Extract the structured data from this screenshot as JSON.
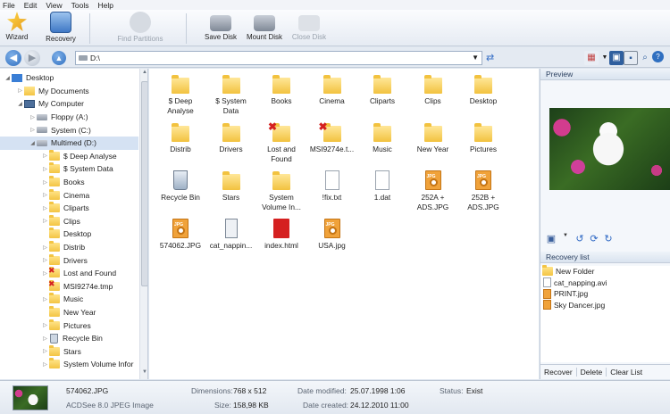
{
  "menu": [
    "File",
    "Edit",
    "View",
    "Tools",
    "Help"
  ],
  "toolbar": {
    "wizard": "Wizard",
    "recovery": "Recovery",
    "find_partitions": "Find Partitions",
    "save_disk": "Save Disk",
    "mount_disk": "Mount Disk",
    "close_disk": "Close Disk"
  },
  "address": {
    "path": "D:\\"
  },
  "tree": [
    {
      "label": "Desktop",
      "icon": "desk"
    },
    {
      "label": "My Documents",
      "icon": "docs"
    },
    {
      "label": "My Computer",
      "icon": "computer"
    },
    {
      "label": "Floppy (A:)",
      "icon": "drive"
    },
    {
      "label": "System (C:)",
      "icon": "drive"
    },
    {
      "label": "Multimed (D:)",
      "icon": "drive"
    },
    {
      "label": "$ Deep Analyse",
      "icon": "folder"
    },
    {
      "label": "$ System Data",
      "icon": "folder"
    },
    {
      "label": "Books",
      "icon": "folder"
    },
    {
      "label": "Cinema",
      "icon": "folder"
    },
    {
      "label": "Cliparts",
      "icon": "folder"
    },
    {
      "label": "Clips",
      "icon": "folder"
    },
    {
      "label": "Desktop",
      "icon": "folder"
    },
    {
      "label": "Distrib",
      "icon": "folder"
    },
    {
      "label": "Drivers",
      "icon": "folder"
    },
    {
      "label": "Lost and Found",
      "icon": "del"
    },
    {
      "label": "MSI9274e.tmp",
      "icon": "del"
    },
    {
      "label": "Music",
      "icon": "folder"
    },
    {
      "label": "New Year",
      "icon": "folder"
    },
    {
      "label": "Pictures",
      "icon": "folder"
    },
    {
      "label": "Recycle Bin",
      "icon": "recycle"
    },
    {
      "label": "Stars",
      "icon": "folder"
    },
    {
      "label": "System Volume Infor",
      "icon": "folder"
    }
  ],
  "files": [
    {
      "l1": "$ Deep",
      "l2": "Analyse",
      "icon": "folder"
    },
    {
      "l1": "$ System",
      "l2": "Data",
      "icon": "folder"
    },
    {
      "l1": "Books",
      "l2": "",
      "icon": "folder"
    },
    {
      "l1": "Cinema",
      "l2": "",
      "icon": "folder"
    },
    {
      "l1": "Cliparts",
      "l2": "",
      "icon": "folder"
    },
    {
      "l1": "Clips",
      "l2": "",
      "icon": "folder"
    },
    {
      "l1": "Desktop",
      "l2": "",
      "icon": "folder"
    },
    {
      "l1": "Distrib",
      "l2": "",
      "icon": "folder"
    },
    {
      "l1": "Drivers",
      "l2": "",
      "icon": "folder"
    },
    {
      "l1": "Lost and",
      "l2": "Found",
      "icon": "folder-del"
    },
    {
      "l1": "MSI9274e.t...",
      "l2": "",
      "icon": "folder-del"
    },
    {
      "l1": "Music",
      "l2": "",
      "icon": "folder"
    },
    {
      "l1": "New Year",
      "l2": "",
      "icon": "folder"
    },
    {
      "l1": "Pictures",
      "l2": "",
      "icon": "folder"
    },
    {
      "l1": "Recycle Bin",
      "l2": "",
      "icon": "recycle"
    },
    {
      "l1": "Stars",
      "l2": "",
      "icon": "folder"
    },
    {
      "l1": "System",
      "l2": "Volume In...",
      "icon": "folder"
    },
    {
      "l1": "!fix.txt",
      "l2": "",
      "icon": "doc"
    },
    {
      "l1": "1.dat",
      "l2": "",
      "icon": "doc"
    },
    {
      "l1": "252A +",
      "l2": "ADS.JPG",
      "icon": "jpg"
    },
    {
      "l1": "252B +",
      "l2": "ADS.JPG",
      "icon": "jpg"
    },
    {
      "l1": "574062.JPG",
      "l2": "",
      "icon": "jpg"
    },
    {
      "l1": "cat_nappin...",
      "l2": "",
      "icon": "avi"
    },
    {
      "l1": "index.html",
      "l2": "",
      "icon": "html"
    },
    {
      "l1": "USA.jpg",
      "l2": "",
      "icon": "jpg"
    }
  ],
  "preview": {
    "title": "Preview"
  },
  "recovery_list": {
    "title": "Recovery list",
    "items": [
      {
        "label": "New Folder",
        "icon": "folder"
      },
      {
        "label": "cat_napping.avi",
        "icon": "file"
      },
      {
        "label": "PRINT.jpg",
        "icon": "jpg"
      },
      {
        "label": "Sky Dancer.jpg",
        "icon": "jpg"
      }
    ],
    "buttons": {
      "recover": "Recover",
      "delete": "Delete",
      "clear": "Clear List"
    }
  },
  "status": {
    "filename": "574062.JPG",
    "type": "ACDSee 8.0 JPEG Image",
    "dimensions_label": "Dimensions:",
    "dimensions": "768 x 512",
    "size_label": "Size:",
    "size": "158,98 KB",
    "modified_label": "Date modified:",
    "modified": "25.07.1998 1:06",
    "created_label": "Date created:",
    "created": "24.12.2010 11:00",
    "status_label": "Status:",
    "status": "Exist"
  }
}
